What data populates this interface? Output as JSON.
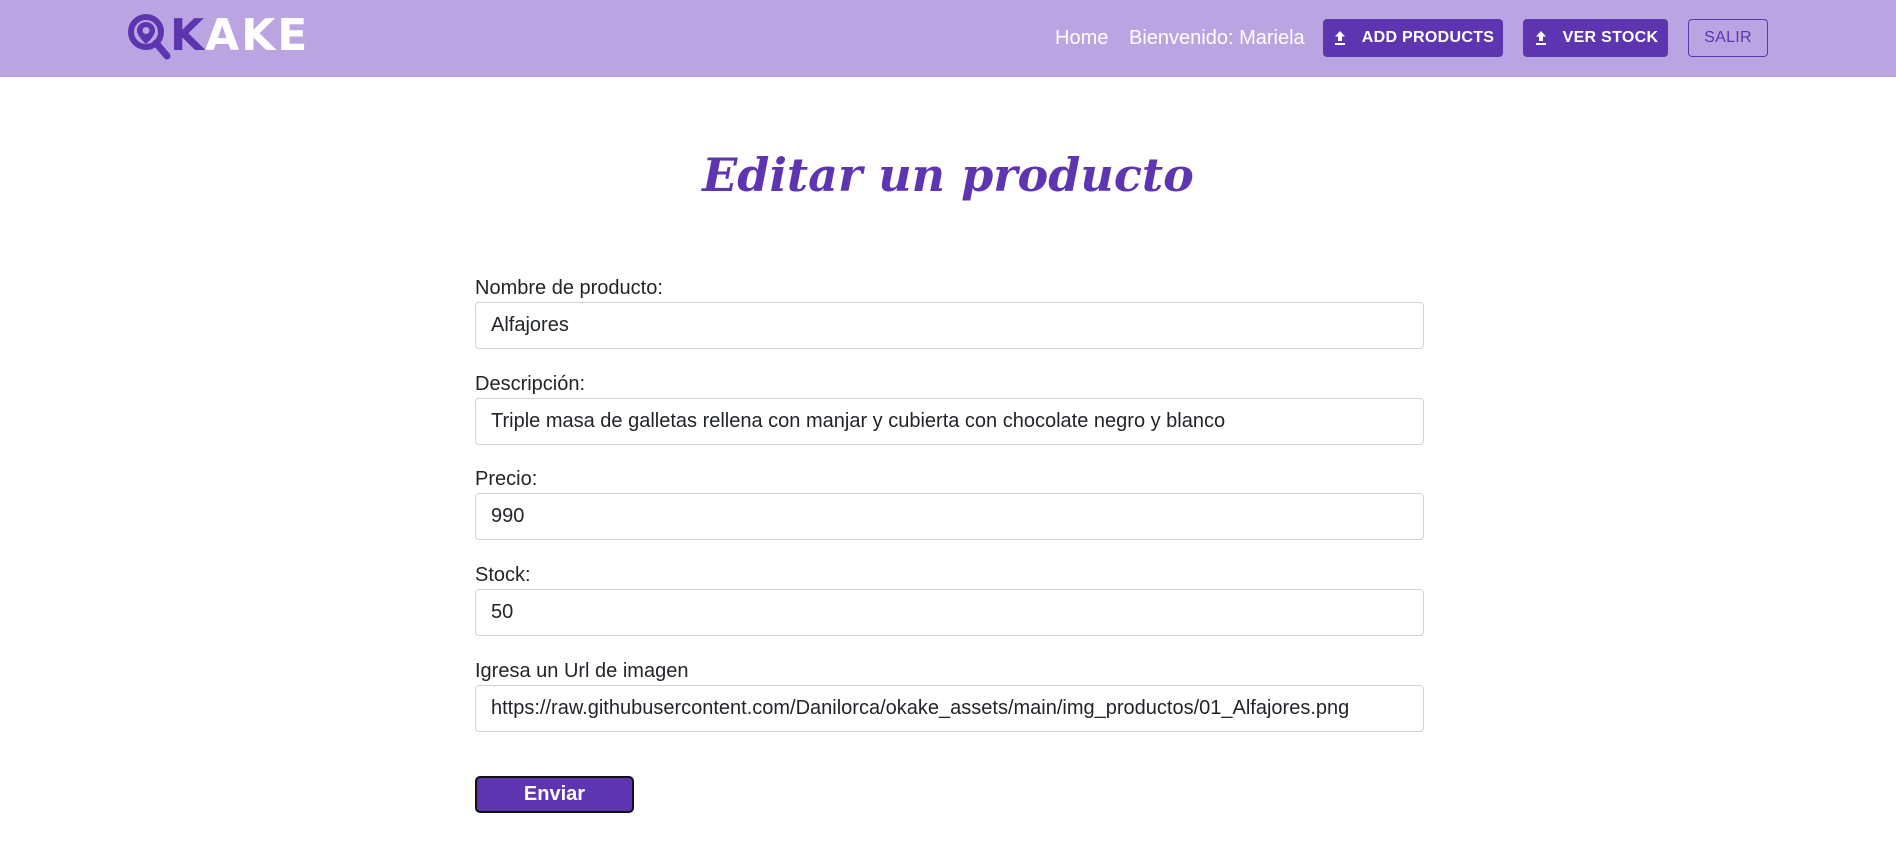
{
  "brand": {
    "logo_first": "K",
    "logo_rest": "AKE",
    "logo_icon": "map-pin-magnifier-icon",
    "primary_color": "#5e35b1",
    "navbar_color": "#bba4e2"
  },
  "nav": {
    "home": "Home",
    "welcome": "Bienvenido: Mariela",
    "add_products": "ADD PRODUCTS",
    "ver_stock": "VER STOCK",
    "salir": "SALIR",
    "upload_icon": "upload-icon"
  },
  "page": {
    "title": "Editar un producto"
  },
  "form": {
    "nombre": {
      "label": "Nombre de producto:",
      "value": "Alfajores"
    },
    "descripcion": {
      "label": "Descripción:",
      "value": "Triple masa de galletas rellena con manjar y cubierta con chocolate negro y blanco"
    },
    "precio": {
      "label": "Precio:",
      "value": "990"
    },
    "stock": {
      "label": "Stock:",
      "value": "50"
    },
    "imagen": {
      "label": "Igresa un Url de imagen",
      "value": "https://raw.githubusercontent.com/Danilorca/okake_assets/main/img_productos/01_Alfajores.png"
    },
    "submit": "Enviar"
  }
}
